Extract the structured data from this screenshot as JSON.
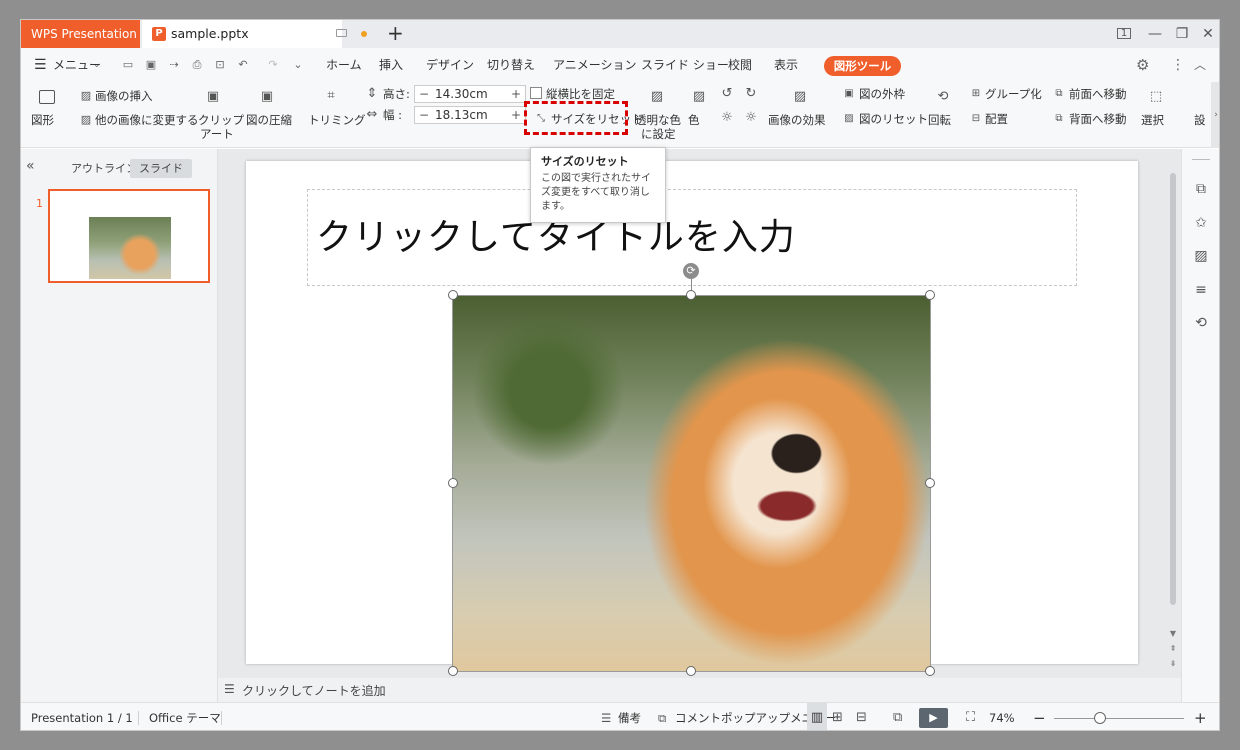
{
  "tabbar": {
    "app_tab": "WPS Presentation",
    "file_icon": "P",
    "file_tab": "sample.pptx",
    "new_tab": "+",
    "window_controls": [
      "1",
      "—",
      "❐",
      "✕"
    ]
  },
  "menubar": {
    "menu_label": "メニュー",
    "tabs": [
      "ホーム",
      "挿入",
      "デザイン",
      "切り替え",
      "アニメーション",
      "スライド ショー",
      "校閲",
      "表示"
    ],
    "active_tool_tab": "図形ツール"
  },
  "ribbon": {
    "shape": "図形",
    "insert_image": "画像の挿入",
    "change_image": "他の画像に変更する",
    "clipart_1": "クリップ",
    "clipart_2": "アート",
    "compress": "図の圧縮",
    "trimming": "トリミング",
    "height_label": "高さ:",
    "height_value": "14.30cm",
    "width_label": "幅 :",
    "width_value": "18.13cm",
    "lock_ratio": "縦横比を固定",
    "reset_size": "サイズをリセット",
    "transparent_1": "透明な色",
    "transparent_2": "に設定",
    "color": "色",
    "image_effects": "画像の効果",
    "outline": "図の外枠",
    "reset_picture": "図のリセット",
    "rotate": "回転",
    "group": "グループ化",
    "align": "配置",
    "bring_forward": "前面へ移動",
    "send_backward": "背面へ移動",
    "select": "選択",
    "settings_cut": "設"
  },
  "tooltip": {
    "title": "サイズのリセット",
    "line1": "この図で実行されたサイ",
    "line2": "ズ変更をすべて取り消し",
    "line3": "ます。"
  },
  "left_panel": {
    "collapse": "«",
    "tab_outline": "アウトライン",
    "tab_slide": "スライド",
    "slide_number": "1"
  },
  "slide": {
    "title_placeholder": "クリックしてタイトルを入力"
  },
  "notes": {
    "placeholder": "クリックしてノートを追加"
  },
  "statusbar": {
    "presentation": "Presentation 1 / 1",
    "theme": "Office テーマ",
    "notes": "備考",
    "comment_popup": "コメントポップアップメニュー",
    "zoom": "74%"
  },
  "colors": {
    "accent": "#f05f2b",
    "highlight_border": "#d90000"
  },
  "icons": {
    "hamburger": "☰",
    "play": "▶",
    "rotate_handle": "⟳"
  }
}
